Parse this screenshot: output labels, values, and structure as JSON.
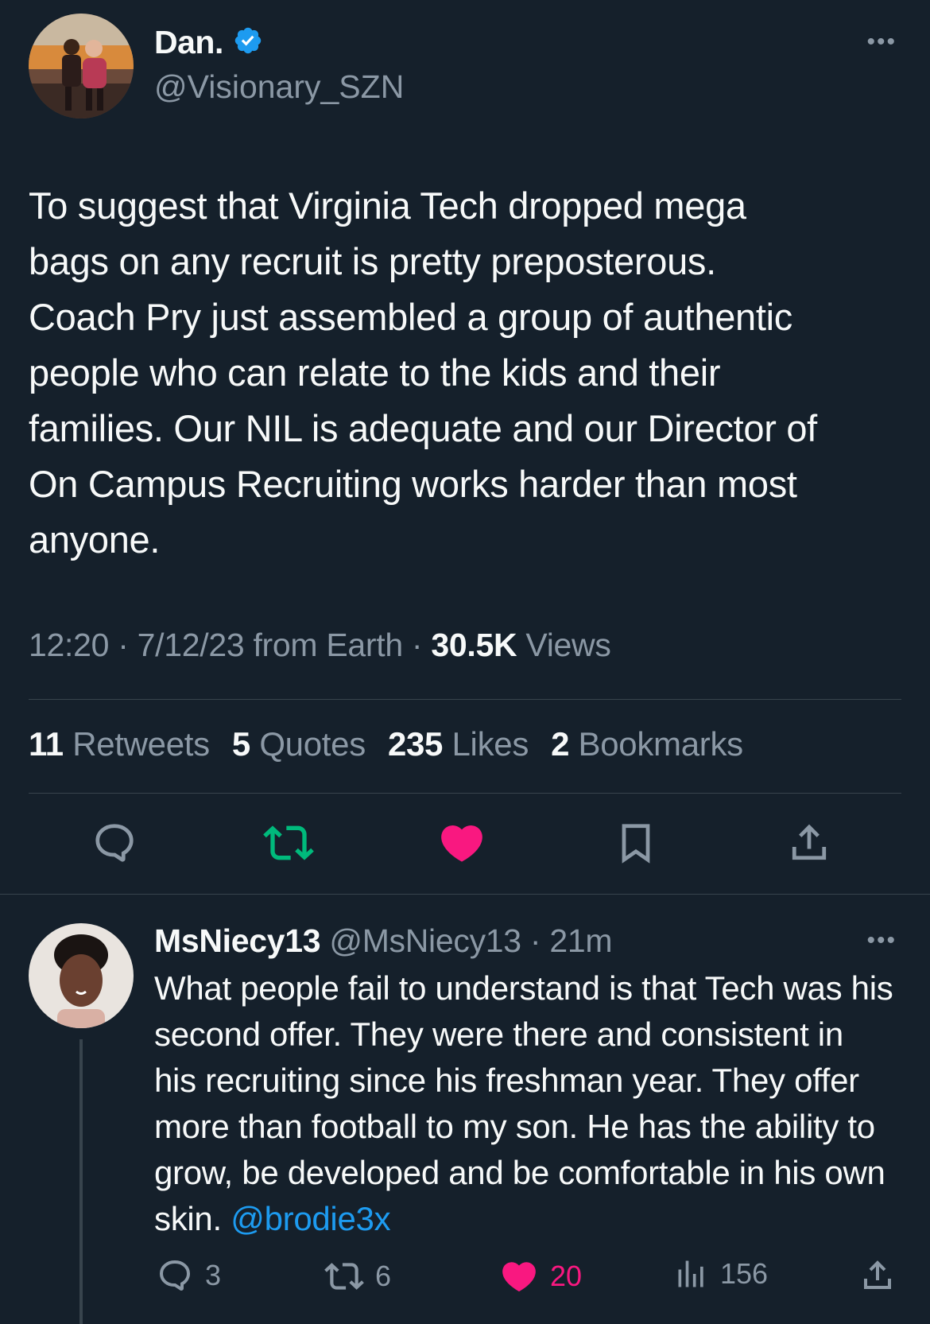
{
  "tweet": {
    "author_name": "Dan.",
    "handle": "@Visionary_SZN",
    "more_label": "•••",
    "text": "To suggest that Virginia Tech dropped mega\nbags on any recruit is pretty preposterous.\nCoach Pry just assembled a group of authentic\npeople who can relate to the kids and their\nfamilies. Our NIL is adequate and our Director of\nOn Campus Recruiting works harder than most\nanyone.",
    "time": "12:20",
    "sep1": " · ",
    "date_source": "7/12/23 from Earth",
    "sep2": " · ",
    "views_count": "30.5K",
    "views_label": " Views",
    "stats": {
      "retweets_count": "11",
      "retweets_label": "Retweets",
      "quotes_count": "5",
      "quotes_label": "Quotes",
      "likes_count": "235",
      "likes_label": "Likes",
      "bookmarks_count": "2",
      "bookmarks_label": "Bookmarks"
    }
  },
  "reply": {
    "name": "MsNiecy13",
    "handle": " @MsNiecy13",
    "sep": " · ",
    "time": "21m",
    "more_label": "•••",
    "text": "What people fail to understand is that Tech was his second offer. They were there and consistent in his recruiting since his freshman year. They offer more than football to my son. He has the ability to grow, be developed and be comfortable in his own skin. ",
    "mention": "@brodie3x",
    "reply_count": "3",
    "retweet_count": "6",
    "like_count": "20",
    "views_count": "156"
  },
  "colors": {
    "background": "#15202b",
    "muted": "#8b98a5",
    "accent_blue": "#1d9bf0",
    "retweet_green": "#00ba7c",
    "like_pink": "#f91880"
  },
  "icons": [
    "verified-badge-icon",
    "reply-icon",
    "retweet-icon",
    "like-icon",
    "bookmark-icon",
    "share-icon",
    "views-icon",
    "more-icon"
  ]
}
